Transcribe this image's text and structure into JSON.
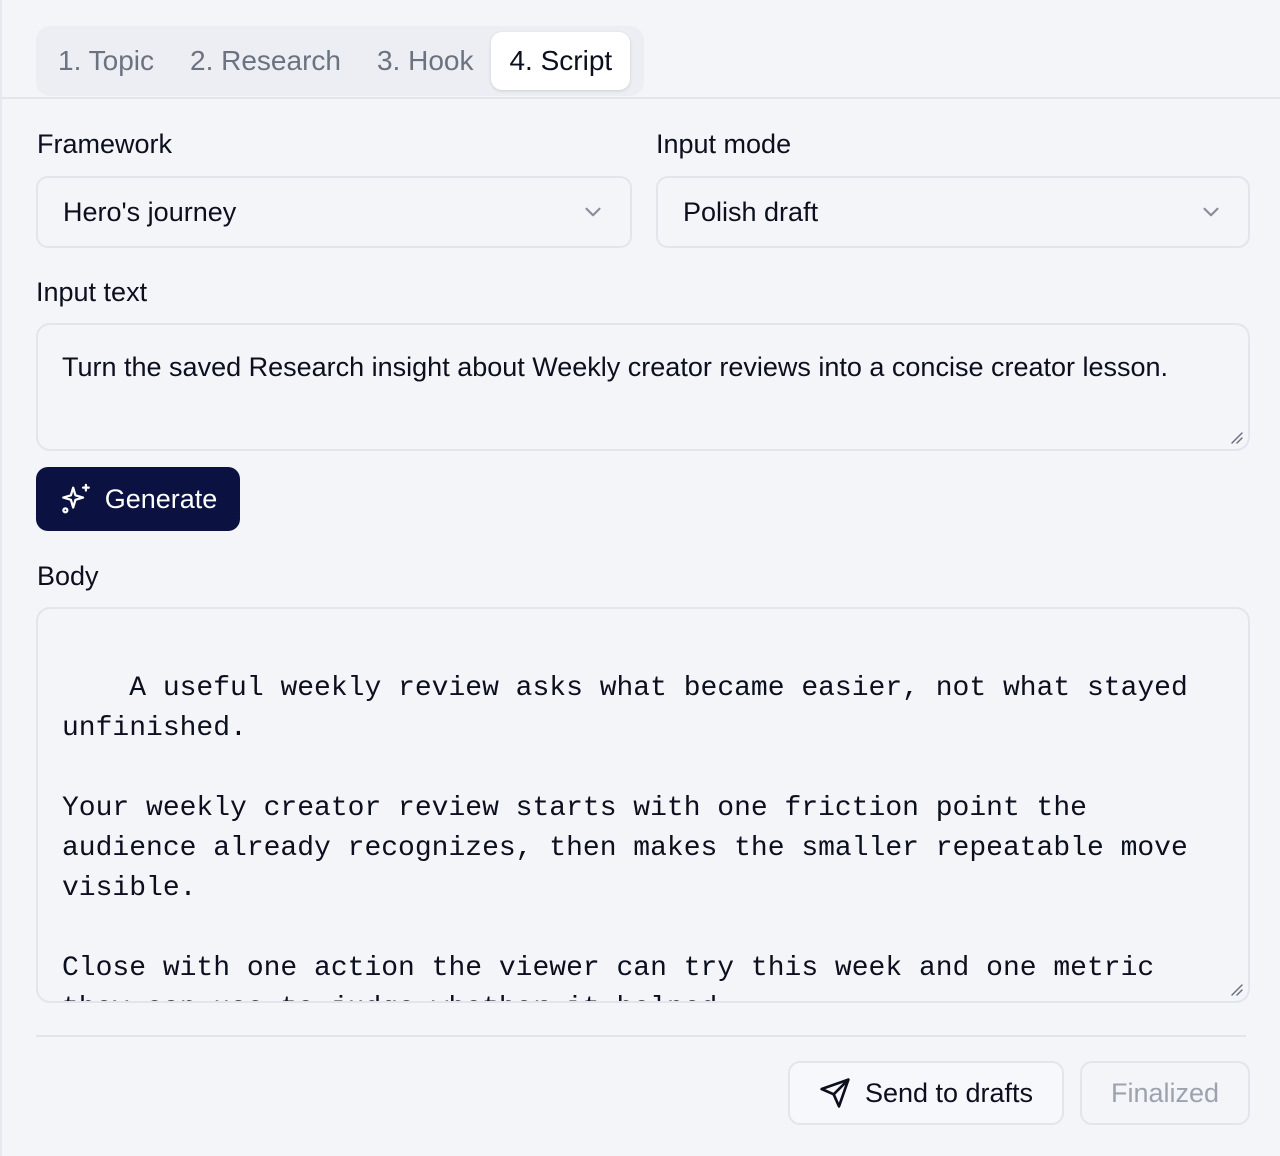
{
  "tabs": [
    {
      "label": "1. Topic",
      "active": false
    },
    {
      "label": "2. Research",
      "active": false
    },
    {
      "label": "3. Hook",
      "active": false
    },
    {
      "label": "4. Script",
      "active": true
    }
  ],
  "framework": {
    "label": "Framework",
    "value": "Hero's journey"
  },
  "input_mode": {
    "label": "Input mode",
    "value": "Polish draft"
  },
  "input_text": {
    "label": "Input text",
    "value": "Turn the saved Research insight about Weekly creator reviews into a concise creator lesson."
  },
  "generate_button": {
    "label": "Generate",
    "icon": "sparkles-icon",
    "color": "#0b1140"
  },
  "body": {
    "label": "Body",
    "value": "A useful weekly review asks what became easier, not what stayed unfinished.\n\nYour weekly creator review starts with one friction point the audience already recognizes, then makes the smaller repeatable move visible.\n\nClose with one action the viewer can try this week and one metric they can use to judge whether it helped."
  },
  "actions": {
    "send_label": "Send to drafts",
    "send_icon": "send-icon",
    "finalized_label": "Finalized"
  }
}
